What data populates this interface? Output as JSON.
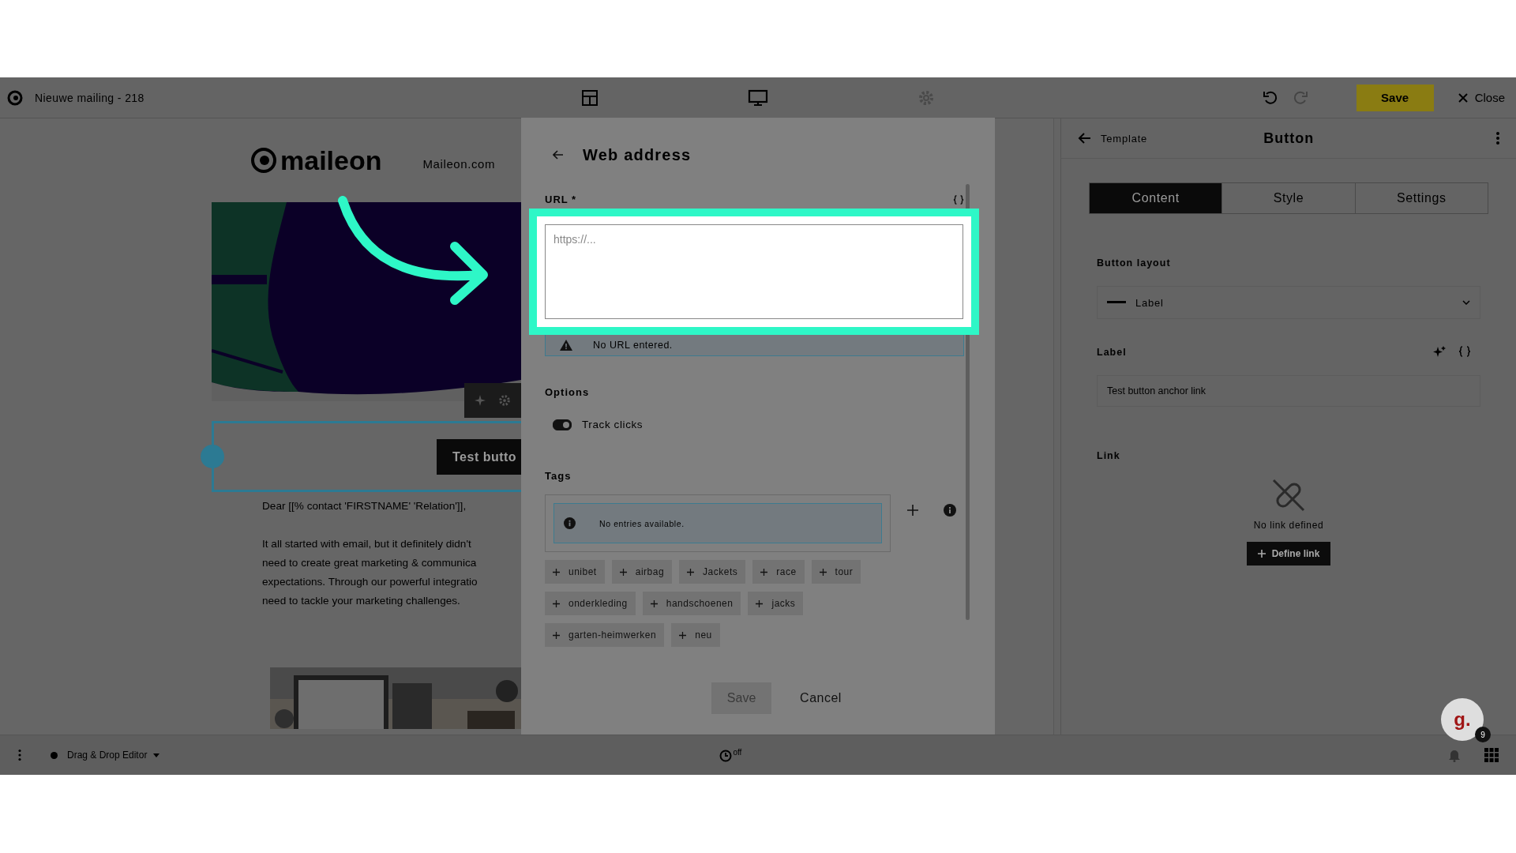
{
  "top_bar": {
    "title": "Nieuwe mailing - 218",
    "save": "Save",
    "close": "Close"
  },
  "email": {
    "logo": "maileon",
    "nav_link": "Maileon.com",
    "button_label": "Test butto",
    "greeting": "Dear [[% contact 'FIRSTNAME' 'Relation']],",
    "body_lines": [
      "It all started with email, but it definitely didn't",
      "need to create great marketing & communica",
      "expectations. Through our powerful integratio",
      "need to tackle your marketing challenges."
    ]
  },
  "panel": {
    "back": "Template",
    "title": "Button",
    "tabs": [
      {
        "label": "Content",
        "selected": true
      },
      {
        "label": "Style",
        "selected": false
      },
      {
        "label": "Settings",
        "selected": false
      }
    ],
    "layout_label": "Button layout",
    "layout_value": "Label",
    "label_label": "Label",
    "label_value": "Test button anchor link",
    "link_label": "Link",
    "empty_link": "No link defined",
    "define_link": "Define link"
  },
  "dialog": {
    "title": "Web address",
    "url_label": "URL *",
    "url_placeholder": "https://...",
    "warning": "No URL entered.",
    "options_heading": "Options",
    "track_clicks": {
      "label": "Track clicks",
      "on": true
    },
    "tags_heading": "Tags",
    "tags_empty": "No entries available.",
    "tags": [
      "unibet",
      "airbag",
      "Jackets",
      "race",
      "tour",
      "onderkleding",
      "handschoenen",
      "jacks",
      "garten-heimwerken",
      "neu"
    ],
    "save": "Save",
    "cancel": "Cancel"
  },
  "bottom_bar": {
    "editor_mode": "Drag & Drop Editor",
    "autosave": "off"
  },
  "help": {
    "logo": "g.",
    "badge": "9"
  }
}
